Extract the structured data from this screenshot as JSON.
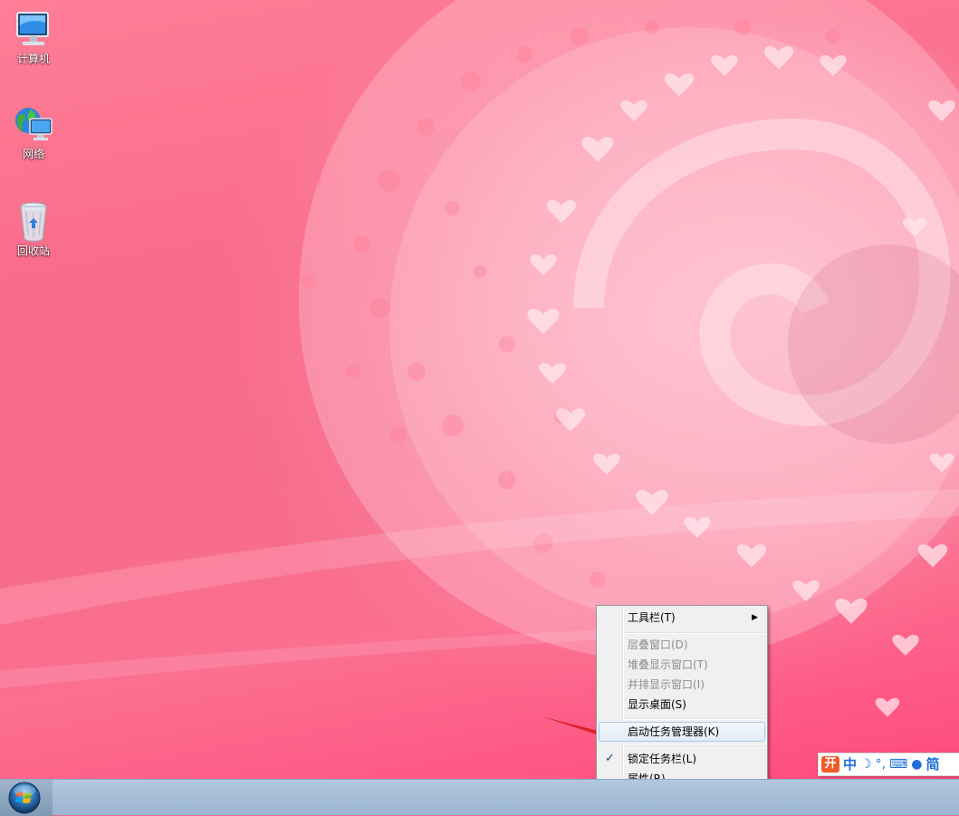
{
  "desktop": {
    "icons": [
      {
        "label": "计算机",
        "icon": "computer-icon"
      },
      {
        "label": "网络",
        "icon": "network-icon"
      },
      {
        "label": "回收站",
        "icon": "recycle-bin-icon"
      }
    ]
  },
  "context_menu": {
    "items": [
      {
        "label": "工具栏(T)",
        "enabled": true,
        "submenu": true
      },
      {
        "label": "层叠窗口(D)",
        "enabled": false
      },
      {
        "label": "堆叠显示窗口(T)",
        "enabled": false
      },
      {
        "label": "并排显示窗口(I)",
        "enabled": false
      },
      {
        "label": "显示桌面(S)",
        "enabled": true
      },
      {
        "label": "启动任务管理器(K)",
        "enabled": true,
        "highlighted": true
      },
      {
        "label": "锁定任务栏(L)",
        "enabled": true,
        "checked": true
      },
      {
        "label": "属性(R)",
        "enabled": true
      }
    ],
    "check_glyph": "✓",
    "submenu_glyph": "▶"
  },
  "ime_bar": {
    "logo": "开",
    "mode": "中",
    "moon": "☽",
    "punct": "°,",
    "keyboard": "⌨",
    "user": "●",
    "script": "简"
  },
  "colors": {
    "taskbar": "#a3bcd6",
    "annotation_arrow": "#e0222a",
    "menu_highlight_border": "#a8c6e8"
  }
}
